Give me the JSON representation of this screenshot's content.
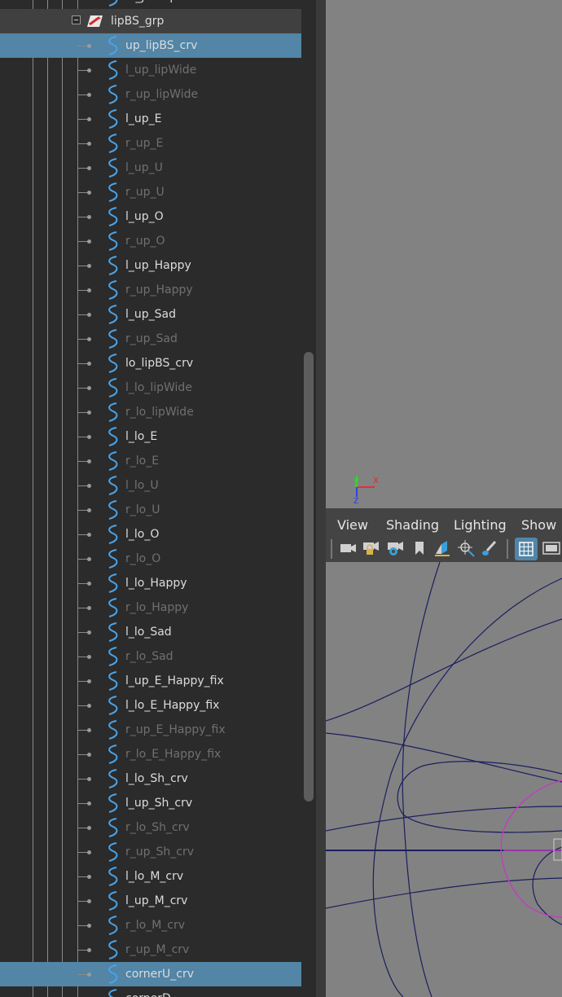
{
  "outliner": {
    "rows": [
      {
        "label": "lo_jawOpenRefCrv",
        "type": "curve",
        "dim": false
      },
      {
        "label": "lipBS_grp",
        "type": "group",
        "dim": false
      },
      {
        "label": "up_lipBS_crv",
        "type": "curve",
        "dim": false,
        "selected": true
      },
      {
        "label": "l_up_lipWide",
        "type": "curve",
        "dim": true
      },
      {
        "label": "r_up_lipWide",
        "type": "curve",
        "dim": true
      },
      {
        "label": "l_up_E",
        "type": "curve",
        "dim": false
      },
      {
        "label": "r_up_E",
        "type": "curve",
        "dim": true
      },
      {
        "label": "l_up_U",
        "type": "curve",
        "dim": true
      },
      {
        "label": "r_up_U",
        "type": "curve",
        "dim": true
      },
      {
        "label": "l_up_O",
        "type": "curve",
        "dim": false
      },
      {
        "label": "r_up_O",
        "type": "curve",
        "dim": true
      },
      {
        "label": "l_up_Happy",
        "type": "curve",
        "dim": false
      },
      {
        "label": "r_up_Happy",
        "type": "curve",
        "dim": true
      },
      {
        "label": "l_up_Sad",
        "type": "curve",
        "dim": false
      },
      {
        "label": "r_up_Sad",
        "type": "curve",
        "dim": true
      },
      {
        "label": "lo_lipBS_crv",
        "type": "curve",
        "dim": false
      },
      {
        "label": "l_lo_lipWide",
        "type": "curve",
        "dim": true
      },
      {
        "label": "r_lo_lipWide",
        "type": "curve",
        "dim": true
      },
      {
        "label": "l_lo_E",
        "type": "curve",
        "dim": false
      },
      {
        "label": "r_lo_E",
        "type": "curve",
        "dim": true
      },
      {
        "label": "l_lo_U",
        "type": "curve",
        "dim": true
      },
      {
        "label": "r_lo_U",
        "type": "curve",
        "dim": true
      },
      {
        "label": "l_lo_O",
        "type": "curve",
        "dim": false
      },
      {
        "label": "r_lo_O",
        "type": "curve",
        "dim": true
      },
      {
        "label": "l_lo_Happy",
        "type": "curve",
        "dim": false
      },
      {
        "label": "r_lo_Happy",
        "type": "curve",
        "dim": true
      },
      {
        "label": "l_lo_Sad",
        "type": "curve",
        "dim": false
      },
      {
        "label": "r_lo_Sad",
        "type": "curve",
        "dim": true
      },
      {
        "label": "l_up_E_Happy_fix",
        "type": "curve",
        "dim": false
      },
      {
        "label": "l_lo_E_Happy_fix",
        "type": "curve",
        "dim": false
      },
      {
        "label": "r_up_E_Happy_fix",
        "type": "curve",
        "dim": true
      },
      {
        "label": "r_lo_E_Happy_fix",
        "type": "curve",
        "dim": true
      },
      {
        "label": "l_lo_Sh_crv",
        "type": "curve",
        "dim": false
      },
      {
        "label": "l_up_Sh_crv",
        "type": "curve",
        "dim": false
      },
      {
        "label": "r_lo_Sh_crv",
        "type": "curve",
        "dim": true
      },
      {
        "label": "r_up_Sh_crv",
        "type": "curve",
        "dim": true
      },
      {
        "label": "l_lo_M_crv",
        "type": "curve",
        "dim": false
      },
      {
        "label": "l_up_M_crv",
        "type": "curve",
        "dim": false
      },
      {
        "label": "r_lo_M_crv",
        "type": "curve",
        "dim": true
      },
      {
        "label": "r_up_M_crv",
        "type": "curve",
        "dim": true
      },
      {
        "label": "cornerU_crv",
        "type": "curve",
        "dim": false,
        "selected": true
      },
      {
        "label": "cornerD",
        "type": "curve",
        "dim": false
      }
    ]
  },
  "viewport": {
    "menu": {
      "view": "View",
      "shading": "Shading",
      "lighting": "Lighting",
      "show": "Show"
    },
    "axis": {
      "x": "x",
      "y": "y",
      "z": "z"
    },
    "toolbar_icons": [
      "camera-icon",
      "camera-lock-icon",
      "camera-attributes-icon",
      "bookmark-icon",
      "image-plane-icon",
      "grease-pencil-icon",
      "paint-icon",
      "grid-icon",
      "film-gate-icon"
    ]
  },
  "colors": {
    "selection": "#5285a6",
    "curve_icon": "#4aa3e8",
    "wire": "#1b1f5e",
    "magenta_wire": "#c23dc2",
    "axis_x": "#e23030",
    "axis_y": "#3ad13a",
    "axis_z": "#2b45e0"
  }
}
